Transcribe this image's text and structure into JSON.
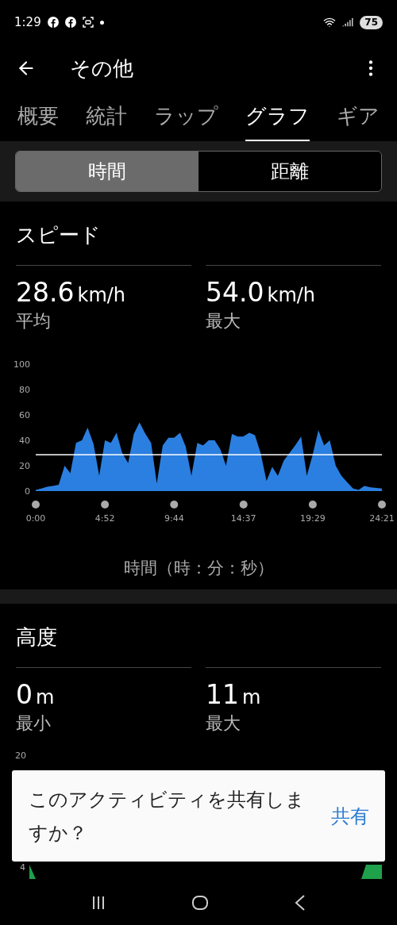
{
  "status_bar": {
    "time": "1:29",
    "battery": "75"
  },
  "header": {
    "title": "その他"
  },
  "tabs": [
    {
      "label": "概要",
      "selected": false
    },
    {
      "label": "統計",
      "selected": false
    },
    {
      "label": "ラップ",
      "selected": false
    },
    {
      "label": "グラフ",
      "selected": true
    },
    {
      "label": "ギア",
      "selected": false
    }
  ],
  "segments": [
    {
      "label": "時間",
      "selected": true
    },
    {
      "label": "距離",
      "selected": false
    }
  ],
  "speed": {
    "title": "スピード",
    "stats": [
      {
        "value": "28.6",
        "unit": "km/h",
        "label": "平均"
      },
      {
        "value": "54.0",
        "unit": "km/h",
        "label": "最大"
      }
    ],
    "chart_data": {
      "type": "area",
      "x": [
        0,
        24,
        49,
        73,
        97,
        122,
        146,
        170,
        195,
        219,
        244,
        268,
        292,
        317,
        341,
        365,
        390,
        414,
        438,
        463,
        487,
        511,
        536,
        560,
        584,
        609,
        633,
        657,
        682,
        706,
        730,
        755,
        779,
        803,
        828,
        852,
        876,
        901,
        925,
        949,
        974,
        998,
        1022,
        1047,
        1071,
        1095,
        1120,
        1144,
        1168,
        1193,
        1217,
        1241,
        1266,
        1290,
        1314,
        1339,
        1363,
        1387,
        1412,
        1436,
        1461
      ],
      "series": [
        {
          "color": "#2b7fe0",
          "values": [
            1,
            2,
            3.5,
            4,
            5,
            20,
            14,
            38,
            40,
            50,
            37,
            12,
            40,
            38,
            46,
            30,
            22,
            45,
            54,
            45,
            38,
            6,
            36,
            42,
            42,
            46,
            35,
            12,
            38,
            36,
            40,
            40,
            33,
            20,
            45,
            43,
            43,
            46,
            44,
            30,
            8,
            19,
            12,
            24,
            30,
            36,
            43,
            12,
            28,
            48,
            36,
            40,
            20,
            12,
            7,
            2,
            1,
            4,
            3,
            2.5,
            2
          ]
        }
      ],
      "xlim": [
        0,
        1461
      ],
      "ylim": [
        0,
        100
      ],
      "xticks": [
        {
          "value": 0,
          "label": "0:00"
        },
        {
          "value": 292,
          "label": "4:52"
        },
        {
          "value": 584,
          "label": "9:44"
        },
        {
          "value": 877,
          "label": "14:37"
        },
        {
          "value": 1169,
          "label": "19:29"
        },
        {
          "value": 1461,
          "label": "24:21"
        }
      ],
      "yticks": [
        0,
        20,
        40,
        60,
        80,
        100
      ],
      "ref_lines": [
        {
          "axis": "y",
          "value": 28.6
        }
      ]
    },
    "axis_title": "時間（時：分：秒）"
  },
  "altitude": {
    "title": "高度",
    "stats": [
      {
        "value": "0",
        "unit": "m",
        "label": "最小"
      },
      {
        "value": "11",
        "unit": "m",
        "label": "最大"
      }
    ],
    "axis_labels": [
      "20",
      "4"
    ]
  },
  "snackbar": {
    "message": "このアクティビティを共有しますか？",
    "action": "共有"
  }
}
